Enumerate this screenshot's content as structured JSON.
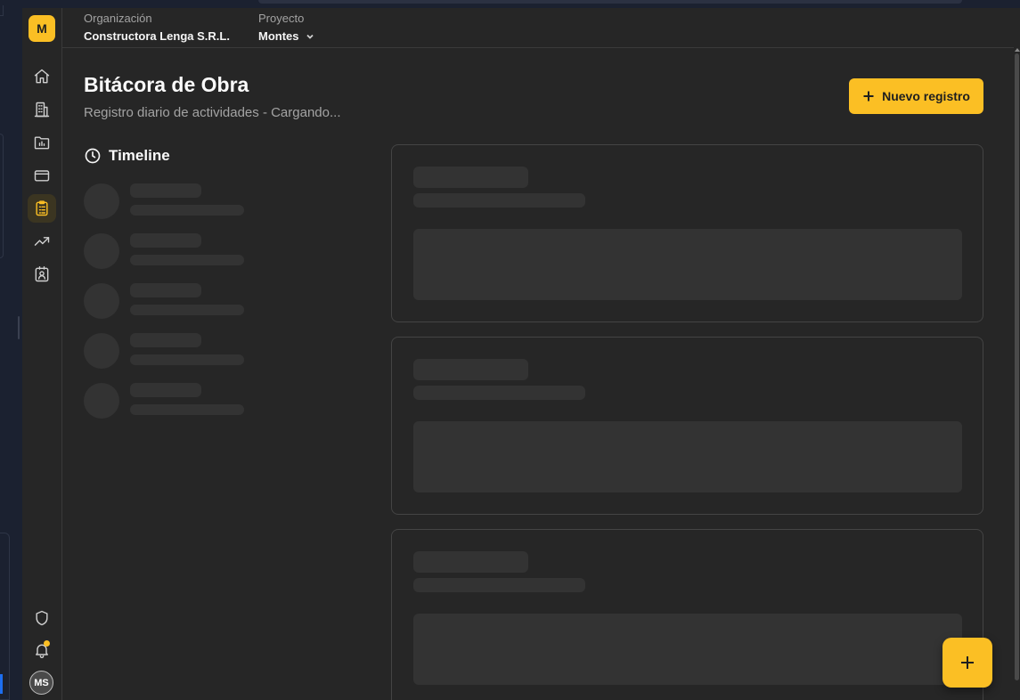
{
  "app": {
    "logo_letter": "M",
    "accent_color": "#fbbf24",
    "user_initials": "MS"
  },
  "sidebar": {
    "items": [
      {
        "icon": "home-icon",
        "active": false
      },
      {
        "icon": "building-icon",
        "active": false
      },
      {
        "icon": "folder-chart-icon",
        "active": false
      },
      {
        "icon": "credit-card-icon",
        "active": false
      },
      {
        "icon": "clipboard-list-icon",
        "active": true
      },
      {
        "icon": "trending-up-icon",
        "active": false
      },
      {
        "icon": "contact-badge-icon",
        "active": false
      }
    ],
    "bottom": [
      {
        "icon": "shield-icon"
      },
      {
        "icon": "bell-icon",
        "has_notification": true
      }
    ]
  },
  "header": {
    "org_label": "Organización",
    "org_value": "Constructora Lenga S.R.L.",
    "project_label": "Proyecto",
    "project_value": "Montes"
  },
  "main": {
    "title": "Bitácora de Obra",
    "subtitle": "Registro diario de actividades - Cargando...",
    "new_button_label": "Nuevo registro",
    "timeline_title": "Timeline"
  }
}
